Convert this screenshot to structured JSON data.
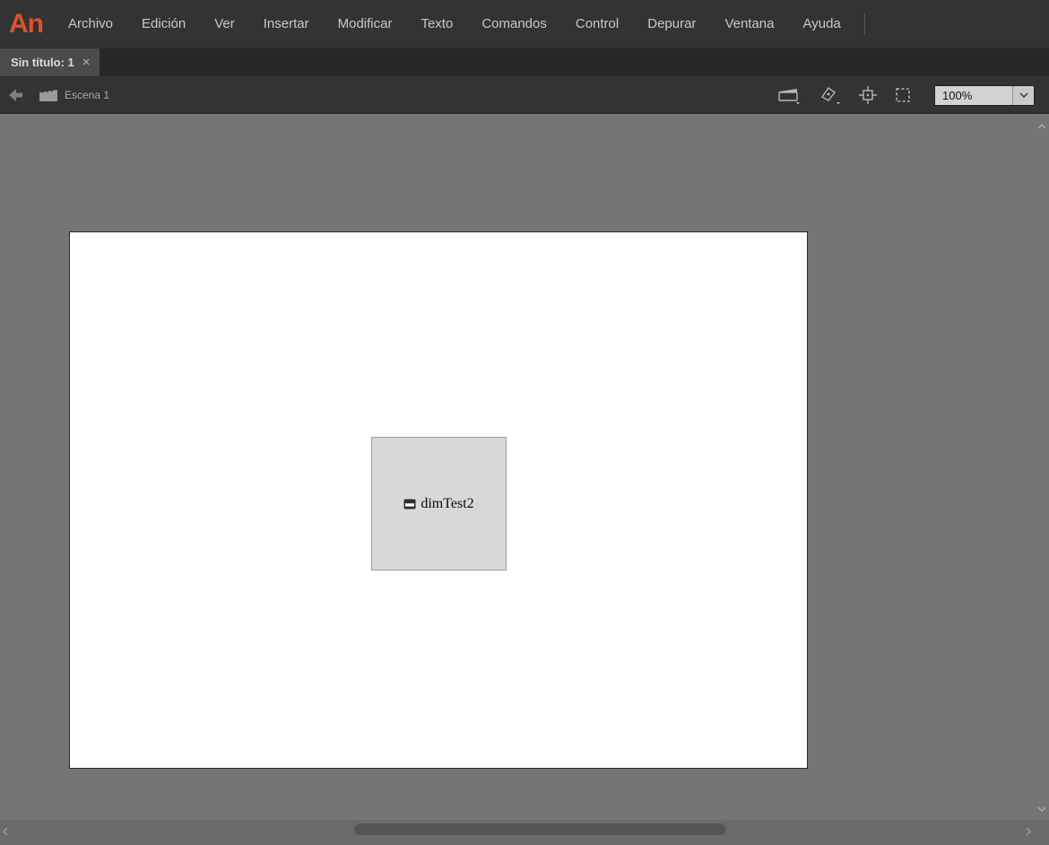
{
  "colors": {
    "menubar_bg": "#333333",
    "tabbar_bg": "#272727",
    "tab_active_bg": "#4b4b4b",
    "editbar_bg": "#333333",
    "pasteboard_bg": "#757575",
    "stage_bg": "#ffffff",
    "symbol_fill": "#d8d8d8",
    "logo_color": "#e0502d",
    "menu_text": "#c9c9c9",
    "scrollbar_track": "#6b6b6b",
    "scrollbar_thumb": "#555555"
  },
  "menubar": {
    "logo": "An",
    "items": [
      "Archivo",
      "Edición",
      "Ver",
      "Insertar",
      "Modificar",
      "Texto",
      "Comandos",
      "Control",
      "Depurar",
      "Ventana",
      "Ayuda"
    ]
  },
  "tabbar": {
    "tab": {
      "label": "Sin título: 1",
      "close_glyph": "×"
    }
  },
  "editbar": {
    "scene_label": "Escena 1",
    "zoom": {
      "value": "100%"
    }
  },
  "stage": {
    "symbol": {
      "label": "dimTest2"
    }
  },
  "icons": {
    "back": "back-arrow-icon",
    "scene": "clapperboard-icon",
    "edit_scene": "edit-scene-clapperboard-icon",
    "edit_symbols": "edit-symbols-icon",
    "center_frame": "center-frame-icon",
    "clip_content": "clip-content-icon",
    "zoom_chevron": "chevron-down-icon",
    "tab_close": "close-icon",
    "symbol_type": "movieclip-icon",
    "scroll_up": "chevron-up-icon",
    "scroll_down": "chevron-down-icon",
    "scroll_left": "chevron-left-icon",
    "scroll_right": "chevron-right-icon"
  }
}
